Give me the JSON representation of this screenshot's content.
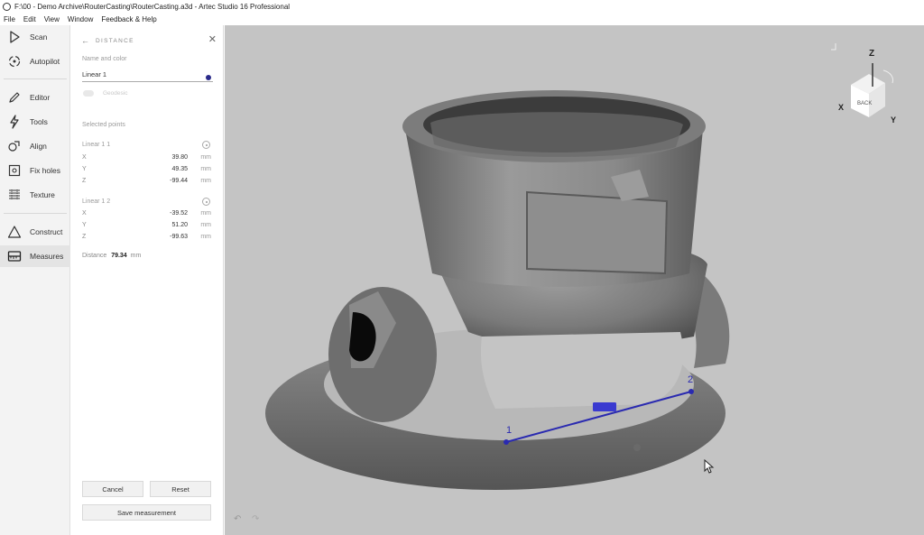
{
  "window": {
    "title": "F:\\00 - Demo Archive\\RouterCasting\\RouterCasting.a3d - Artec Studio 16 Professional"
  },
  "menu": [
    "File",
    "Edit",
    "View",
    "Window",
    "Feedback & Help"
  ],
  "toolbar": {
    "items": [
      {
        "label": "Scan",
        "icon": "play-triangle-icon"
      },
      {
        "label": "Autopilot",
        "icon": "autopilot-icon"
      },
      {
        "label": "Editor",
        "icon": "pencil-icon"
      },
      {
        "label": "Tools",
        "icon": "lightning-icon"
      },
      {
        "label": "Align",
        "icon": "align-icon"
      },
      {
        "label": "Fix holes",
        "icon": "fix-holes-icon"
      },
      {
        "label": "Texture",
        "icon": "texture-grid-icon"
      },
      {
        "label": "Construct",
        "icon": "triangle-icon"
      },
      {
        "label": "Measures",
        "icon": "measures-icon"
      }
    ],
    "active": "Measures"
  },
  "panel": {
    "title": "DISTANCE",
    "name_color_label": "Name and color",
    "name_value": "Linear 1",
    "color": "#2a2a8a",
    "geodesic_label": "Geodesic",
    "selected_points_label": "Selected points",
    "points": [
      {
        "label": "Linear 1 1",
        "coords": [
          {
            "axis": "X",
            "value": "39.80",
            "unit": "mm"
          },
          {
            "axis": "Y",
            "value": "49.35",
            "unit": "mm"
          },
          {
            "axis": "Z",
            "value": "-99.44",
            "unit": "mm"
          }
        ]
      },
      {
        "label": "Linear 1 2",
        "coords": [
          {
            "axis": "X",
            "value": "-39.52",
            "unit": "mm"
          },
          {
            "axis": "Y",
            "value": "51.20",
            "unit": "mm"
          },
          {
            "axis": "Z",
            "value": "-99.63",
            "unit": "mm"
          }
        ]
      }
    ],
    "distance_label": "Distance",
    "distance_value": "79.34",
    "distance_unit": "mm",
    "cancel_label": "Cancel",
    "reset_label": "Reset",
    "save_label": "Save measurement"
  },
  "viewport": {
    "background": "#c4c4c4",
    "measure_color": "#2a2ab0",
    "point_labels": [
      "1",
      "2"
    ],
    "view_cube": {
      "face": "BACK",
      "axes": [
        "Z",
        "X",
        "Y"
      ]
    }
  }
}
